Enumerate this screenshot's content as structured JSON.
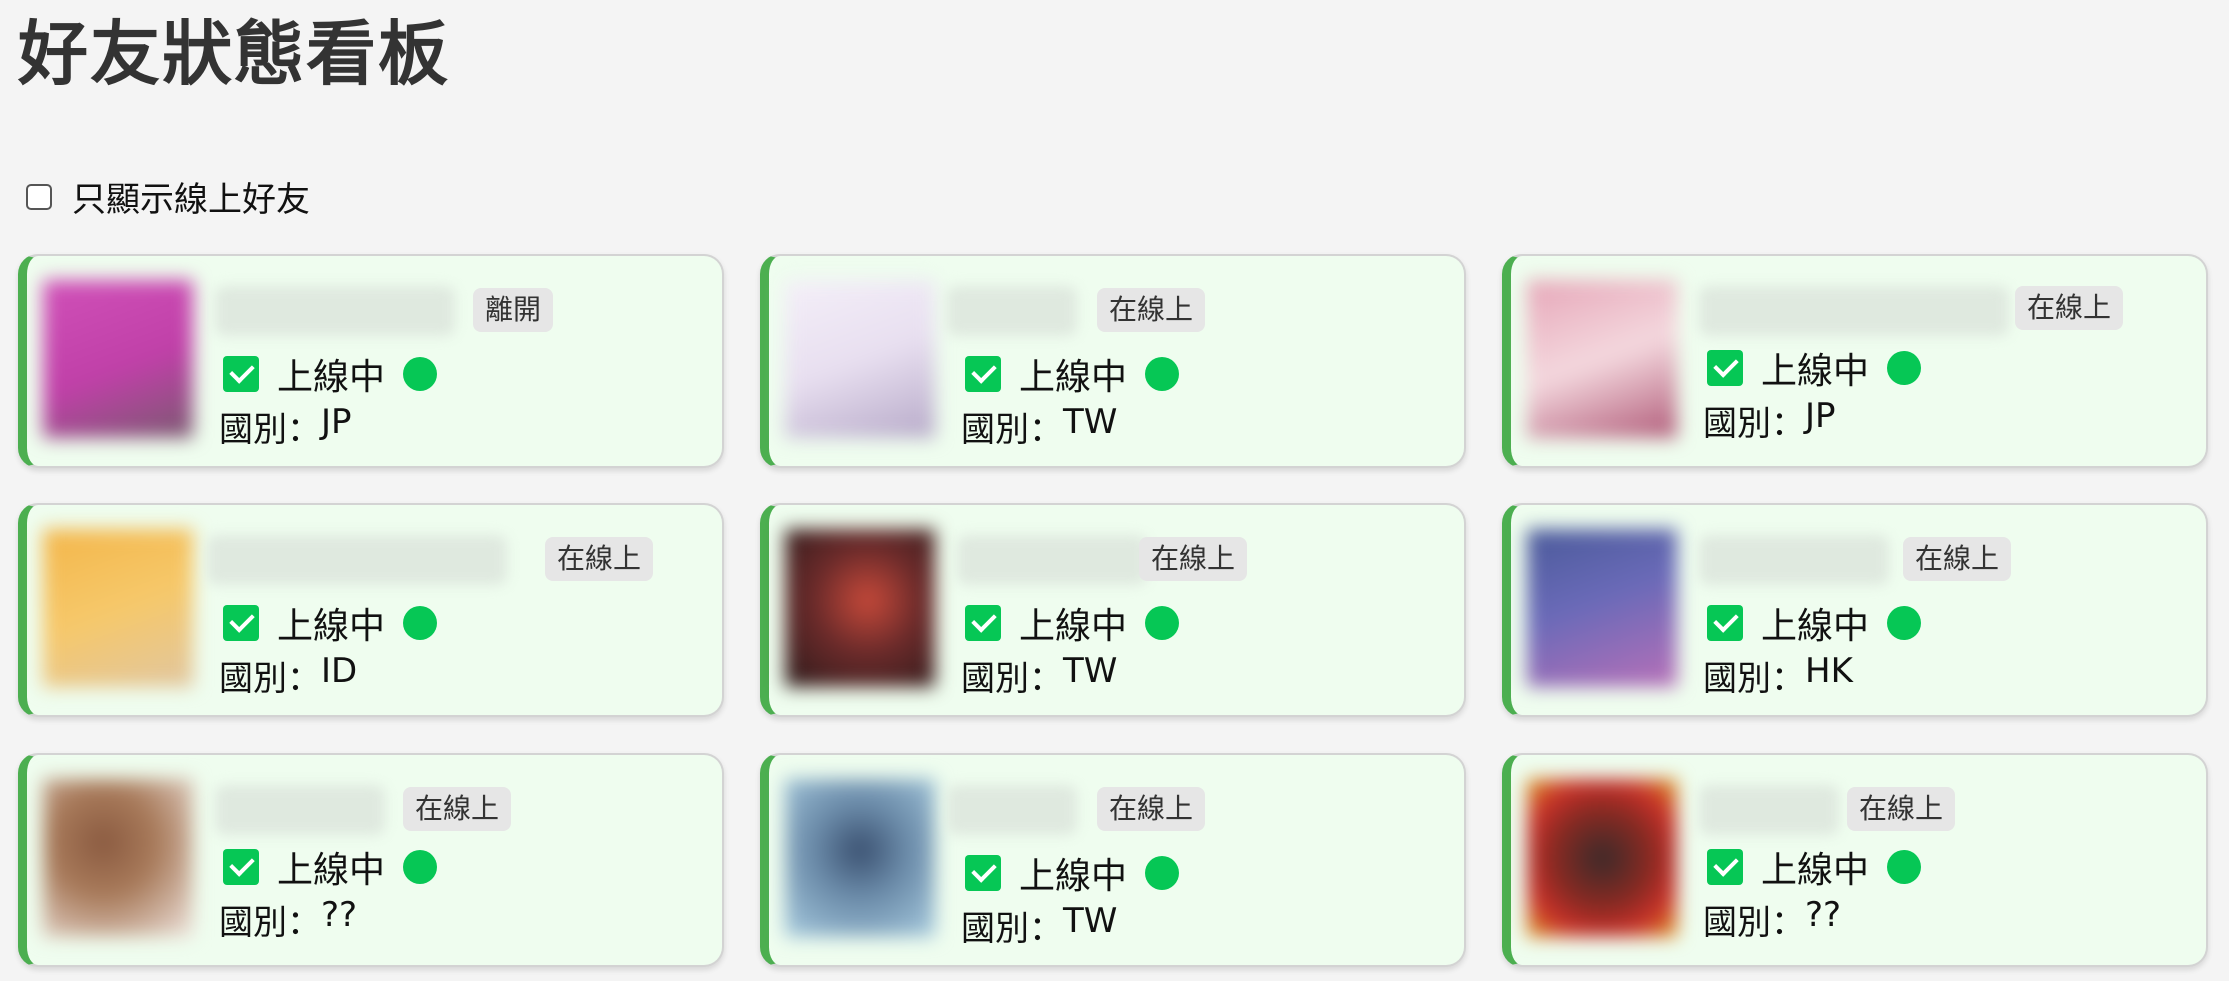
{
  "page": {
    "title": "好友狀態看板"
  },
  "filter": {
    "label": "只顯示線上好友",
    "checked": false
  },
  "labels": {
    "online_status": "上線中",
    "country_prefix": "國別："
  },
  "colors": {
    "accent": "#4caf50",
    "line_green": "#06c755",
    "card_bg": "#effdef",
    "badge_bg": "#e6e6e6"
  },
  "friends": [
    {
      "badge": "離開",
      "country": "JP",
      "avatar_color": "#d050b8",
      "avatar_shade": "#7a5a70"
    },
    {
      "badge": "在線上",
      "country": "TW",
      "avatar_color": "#e8dff0",
      "avatar_shade": "#b6a9c8"
    },
    {
      "badge": "在線上",
      "country": "JP",
      "avatar_color": "#e6a6b8",
      "avatar_shade": "#b05a78"
    },
    {
      "badge": "在線上",
      "country": "ID",
      "avatar_color": "#f3b64a",
      "avatar_shade": "#e0c6a0"
    },
    {
      "badge": "在線上",
      "country": "TW",
      "avatar_color": "#2a1a1a",
      "avatar_shade": "#c84a3a"
    },
    {
      "badge": "在線上",
      "country": "HK",
      "avatar_color": "#4a5a9a",
      "avatar_shade": "#b870b8"
    },
    {
      "badge": "在線上",
      "country": "??",
      "avatar_color": "#8a5a40",
      "avatar_shade": "#f0e6e0"
    },
    {
      "badge": "在線上",
      "country": "TW",
      "avatar_color": "#a8cce0",
      "avatar_shade": "#3a5070"
    },
    {
      "badge": "在線上",
      "country": "??",
      "avatar_color": "#c8302a",
      "avatar_shade": "#3a2a2a"
    }
  ]
}
